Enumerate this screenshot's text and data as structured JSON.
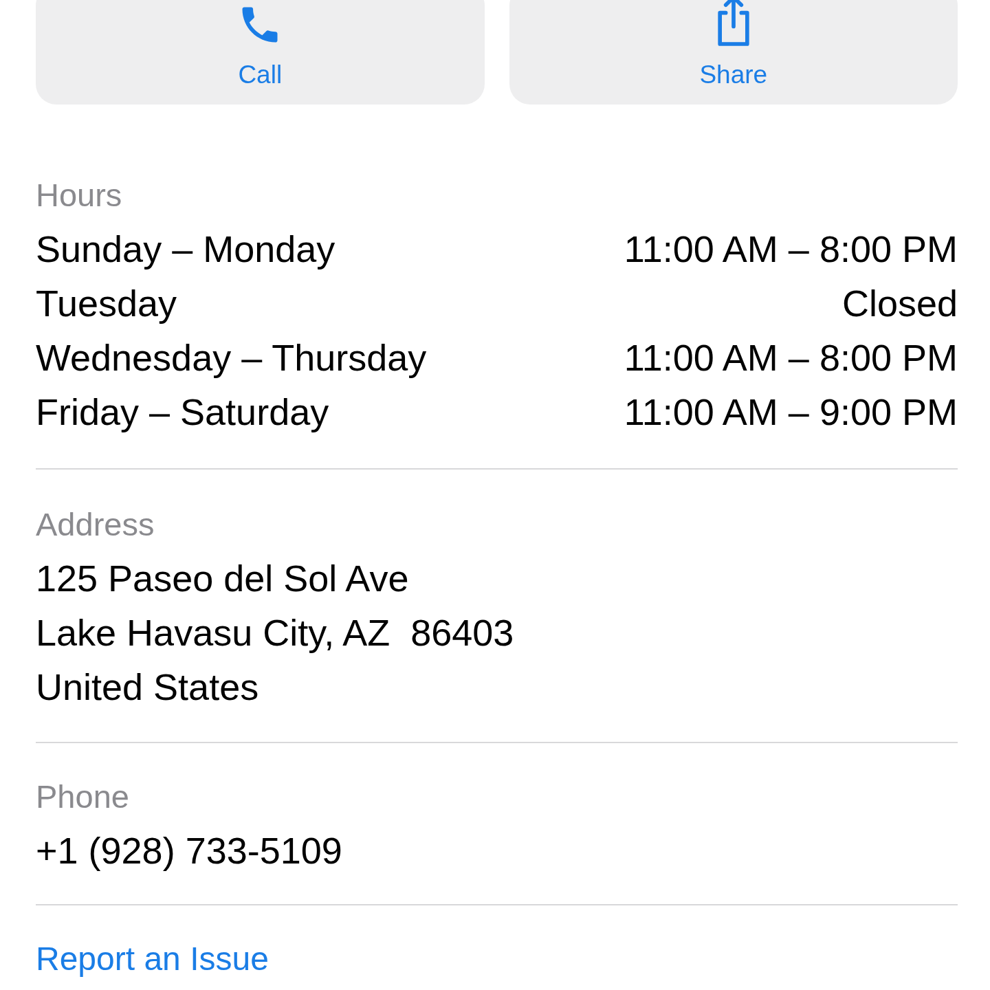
{
  "actions": [
    {
      "kind": "call",
      "label": "Call"
    },
    {
      "kind": "share",
      "label": "Share"
    }
  ],
  "hours": {
    "label": "Hours",
    "rows": [
      {
        "days": "Sunday – Monday",
        "time": "11:00 AM – 8:00 PM"
      },
      {
        "days": "Tuesday",
        "time": "Closed"
      },
      {
        "days": "Wednesday – Thursday",
        "time": "11:00 AM – 8:00 PM"
      },
      {
        "days": "Friday – Saturday",
        "time": "11:00 AM – 9:00 PM"
      }
    ]
  },
  "address": {
    "label": "Address",
    "lines": [
      "125 Paseo del Sol Ave",
      "Lake Havasu City, AZ  86403",
      "United States"
    ]
  },
  "phone": {
    "label": "Phone",
    "number": "+1 (928) 733-5109"
  },
  "report_link": "Report an Issue"
}
